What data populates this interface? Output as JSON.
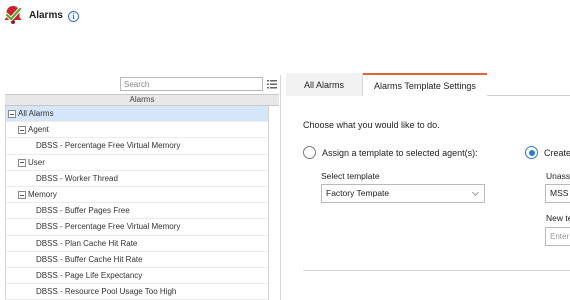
{
  "header": {
    "title": "Alarms",
    "info_glyph": "i",
    "logo_icon": "alarm-bell-check-icon",
    "colors": {
      "logo_red": "#c9242b",
      "logo_check": "#5aa72f",
      "info_blue": "#2f6ed6"
    }
  },
  "left_panel": {
    "search_placeholder": "Search",
    "columns_icon": "columns-menu-icon",
    "tree_header": "Alarms",
    "tree": [
      {
        "label": "All Alarms",
        "level": 0,
        "expandable": true,
        "selected": true
      },
      {
        "label": "Agent",
        "level": 1,
        "expandable": true
      },
      {
        "label": "DBSS - Percentage Free Virtual Memory",
        "level": 2,
        "expandable": false
      },
      {
        "label": "User",
        "level": 1,
        "expandable": true
      },
      {
        "label": "DBSS - Worker Thread",
        "level": 2,
        "expandable": false
      },
      {
        "label": "Memory",
        "level": 1,
        "expandable": true
      },
      {
        "label": "DBSS - Buffer Pages Free",
        "level": 2,
        "expandable": false
      },
      {
        "label": "DBSS - Percentage Free Virtual Memory",
        "level": 2,
        "expandable": false
      },
      {
        "label": "DBSS - Plan Cache Hit Rate",
        "level": 2,
        "expandable": false
      },
      {
        "label": "DBSS - Buffer Cache Hit Rate",
        "level": 2,
        "expandable": false
      },
      {
        "label": "DBSS - Page Life Expectancy",
        "level": 2,
        "expandable": false
      },
      {
        "label": "DBSS - Resource Pool Usage Too High",
        "level": 2,
        "expandable": false
      }
    ]
  },
  "right_panel": {
    "tabs": [
      {
        "label": "All Alarms",
        "active": false
      },
      {
        "label": "Alarms Template Settings",
        "active": true
      }
    ],
    "accent_color": "#e3613a",
    "instruction": "Choose what you would like to do.",
    "option_assign": {
      "label": "Assign a template to selected agent(s):",
      "checked": false
    },
    "option_create": {
      "label": "Create",
      "checked": true
    },
    "select_template_label": "Select template",
    "select_template_value": "Factory Tempate",
    "unassigned_label": "Unass",
    "unassigned_value": "MSS",
    "new_template_label": "New te",
    "new_template_placeholder": "Enter"
  }
}
